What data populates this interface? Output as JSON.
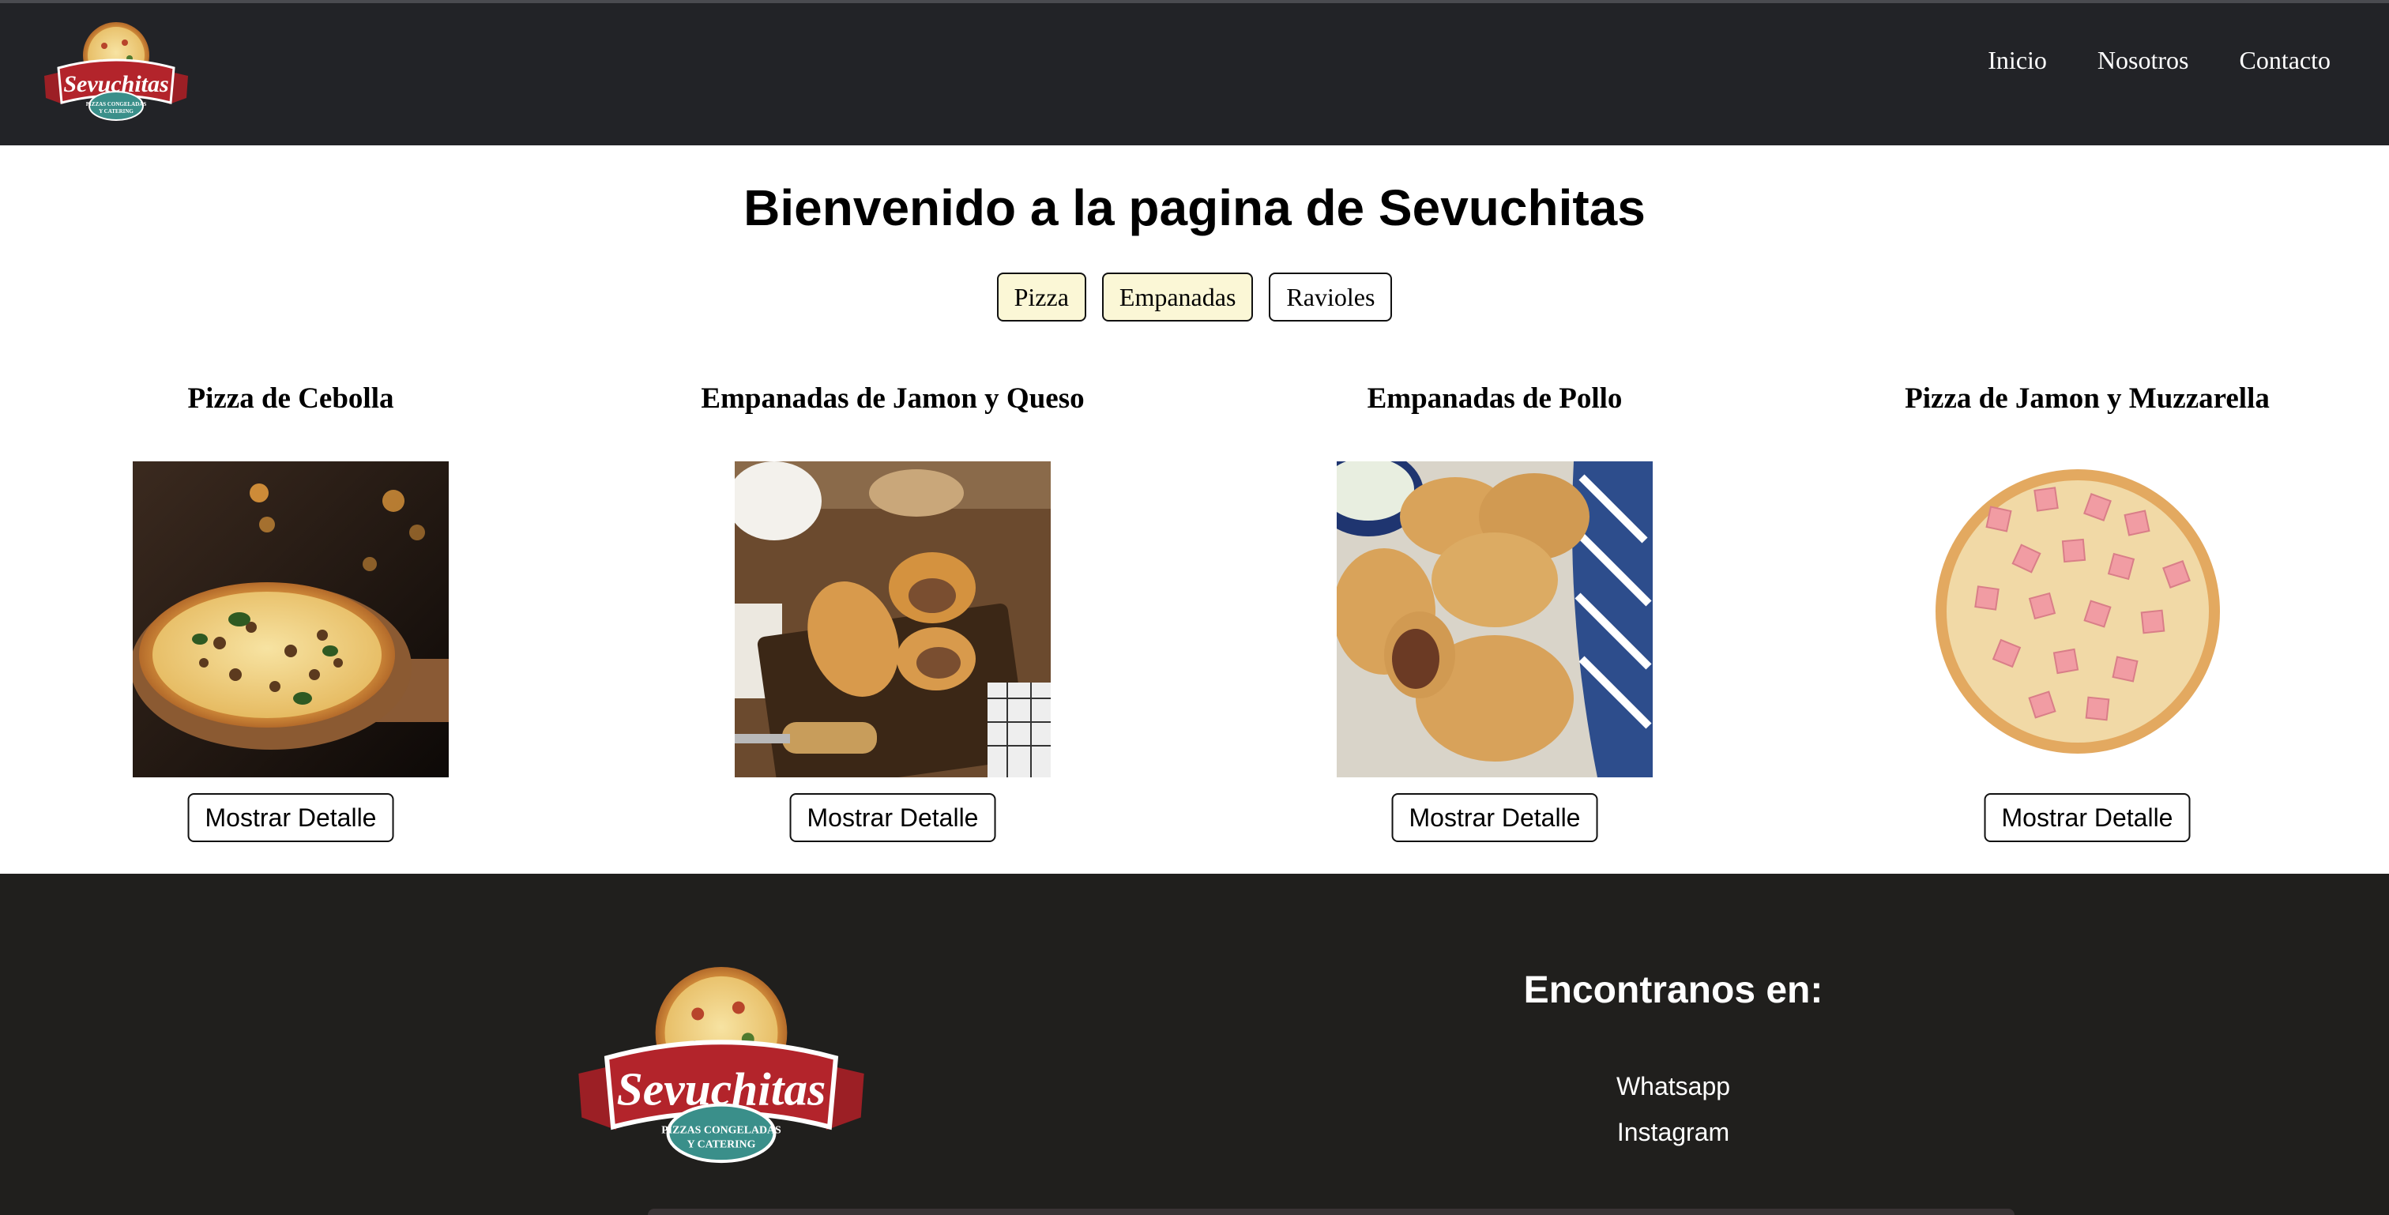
{
  "brand": {
    "name": "Sevuchitas",
    "tagline_1": "PIZZAS CONGELADAS",
    "tagline_2": "Y CATERING",
    "colors": {
      "red": "#b3242b",
      "teal": "#3a8f8a",
      "nav_bg": "#222327",
      "footer_bg": "#201f1d",
      "filter_active": "#fbf7d6"
    }
  },
  "nav": {
    "links": [
      {
        "label": "Inicio"
      },
      {
        "label": "Nosotros"
      },
      {
        "label": "Contacto"
      }
    ]
  },
  "main": {
    "title": "Bienvenido a la pagina de Sevuchitas",
    "filters": [
      {
        "label": "Pizza",
        "active": true
      },
      {
        "label": "Empanadas",
        "active": true
      },
      {
        "label": "Ravioles",
        "active": false
      }
    ],
    "products": [
      {
        "title": "Pizza de Cebolla",
        "image_icon": "onion-pizza-photo",
        "button": "Mostrar Detalle"
      },
      {
        "title": "Empanadas de Jamon y Queso",
        "image_icon": "ham-cheese-empanadas-photo",
        "button": "Mostrar Detalle"
      },
      {
        "title": "Empanadas de Pollo",
        "image_icon": "chicken-empanadas-photo",
        "button": "Mostrar Detalle"
      },
      {
        "title": "Pizza de Jamon y Muzzarella",
        "image_icon": "ham-mozzarella-pizza-photo",
        "button": "Mostrar Detalle"
      }
    ]
  },
  "footer": {
    "title": "Encontranos en:",
    "links": [
      {
        "label": "Whatsapp"
      },
      {
        "label": "Instagram"
      }
    ]
  }
}
